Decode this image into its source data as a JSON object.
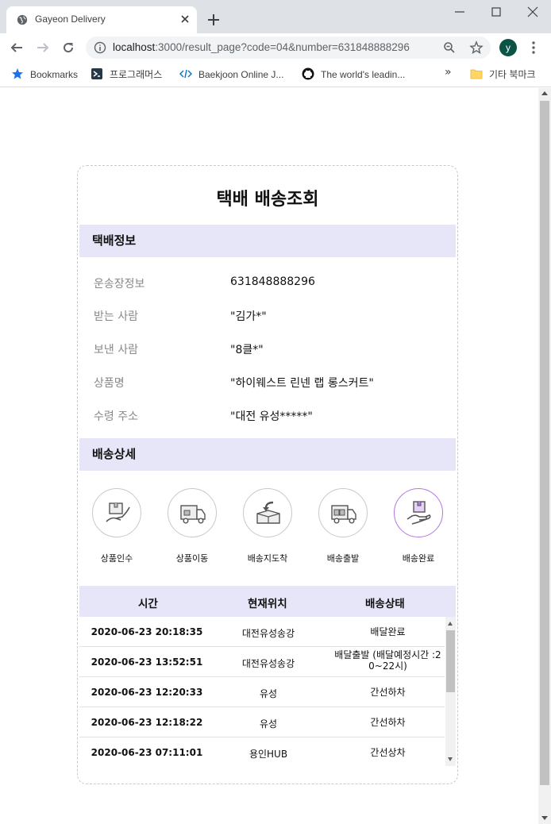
{
  "browser": {
    "tab_title": "Gayeon Delivery",
    "url_host": "localhost",
    "url_rest": ":3000/result_page?code=04&number=631848888296",
    "avatar_letter": "y",
    "bookmarks": [
      "Bookmarks",
      "프로그래머스",
      "Baekjoon Online J...",
      "The world's leadin..."
    ],
    "overflow": "»",
    "other_bookmarks": "기타 북마크"
  },
  "page": {
    "title": "택배 배송조회",
    "info_section": "택배정보",
    "detail_section": "배송상세",
    "info": [
      {
        "label": "운송장정보",
        "value": "631848888296"
      },
      {
        "label": "받는 사람",
        "value": "\"김가*\""
      },
      {
        "label": "보낸 사람",
        "value": "\"8클*\""
      },
      {
        "label": "상품명",
        "value": "\"하이웨스트 린넨 랩 롱스커트\""
      },
      {
        "label": "수령 주소",
        "value": "\"대전 유성*****\""
      }
    ],
    "steps": [
      {
        "label": "상품인수",
        "icon": "hand-box-icon",
        "active": false
      },
      {
        "label": "상품이동",
        "icon": "truck-icon",
        "active": false
      },
      {
        "label": "배송지도착",
        "icon": "box-arrival-icon",
        "active": false
      },
      {
        "label": "배송출발",
        "icon": "truck-departure-icon",
        "active": false
      },
      {
        "label": "배송완료",
        "icon": "hand-delivered-icon",
        "active": true
      }
    ],
    "table": {
      "headers": [
        "시간",
        "현재위치",
        "배송상태"
      ],
      "rows": [
        {
          "time": "2020-06-23 20:18:35",
          "location": "대전유성송강",
          "status": "배달완료",
          "status2": ""
        },
        {
          "time": "2020-06-23 13:52:51",
          "location": "대전유성송강",
          "status": "배달출발 (배달예정시간 :2",
          "status2": "0~22시)"
        },
        {
          "time": "2020-06-23 12:20:33",
          "location": "유성",
          "status": "간선하차",
          "status2": ""
        },
        {
          "time": "2020-06-23 12:18:22",
          "location": "유성",
          "status": "간선하차",
          "status2": ""
        },
        {
          "time": "2020-06-23 07:11:01",
          "location": "용인HUB",
          "status": "간선상차",
          "status2": ""
        }
      ]
    }
  },
  "colors": {
    "section_bg": "#e6e6f8",
    "active_step": "#b276e0",
    "avatar": "#0b5345"
  }
}
